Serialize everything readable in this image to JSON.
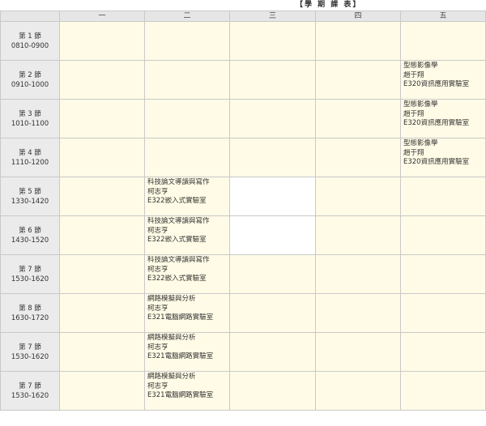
{
  "title": "【學 期 課 表】",
  "days": [
    "一",
    "二",
    "三",
    "四",
    "五"
  ],
  "periods": [
    {
      "label": "第 1 節",
      "time": "0810-0900"
    },
    {
      "label": "第 2 節",
      "time": "0910-1000"
    },
    {
      "label": "第 3 節",
      "time": "1010-1100"
    },
    {
      "label": "第 4 節",
      "time": "1110-1200"
    },
    {
      "label": "第 5 節",
      "time": "1330-1420"
    },
    {
      "label": "第 6 節",
      "time": "1430-1520"
    },
    {
      "label": "第 7 節",
      "time": "1530-1620"
    },
    {
      "label": "第 8 節",
      "time": "1630-1720"
    },
    {
      "label": "第 7 節",
      "time": "1530-1620"
    },
    {
      "label": "第 7 節",
      "time": "1530-1620"
    }
  ],
  "courses": {
    "fri_2": {
      "name": "型態影像學",
      "teacher": "趙于翔",
      "room": "E320資訊應用實驗室"
    },
    "fri_3": {
      "name": "型態影像學",
      "teacher": "趙于翔",
      "room": "E320資訊應用實驗室"
    },
    "fri_4": {
      "name": "型態影像學",
      "teacher": "趙于翔",
      "room": "E320資訊應用實驗室"
    },
    "tue_5": {
      "name": "科技論文導讀與寫作",
      "teacher": "柯志亨",
      "room": "E322嵌入式實驗室"
    },
    "tue_6": {
      "name": "科技論文導讀與寫作",
      "teacher": "柯志亨",
      "room": "E322嵌入式實驗室"
    },
    "tue_7": {
      "name": "科技論文導讀與寫作",
      "teacher": "柯志亨",
      "room": "E322嵌入式實驗室"
    },
    "tue_8": {
      "name": "網路模擬與分析",
      "teacher": "柯志亨",
      "room": "E321電腦網路實驗室"
    },
    "tue_9": {
      "name": "網路模擬與分析",
      "teacher": "柯志亨",
      "room": "E321電腦網路實驗室"
    },
    "tue_10": {
      "name": "網路模擬與分析",
      "teacher": "柯志亨",
      "room": "E321電腦網路實驗室"
    }
  }
}
